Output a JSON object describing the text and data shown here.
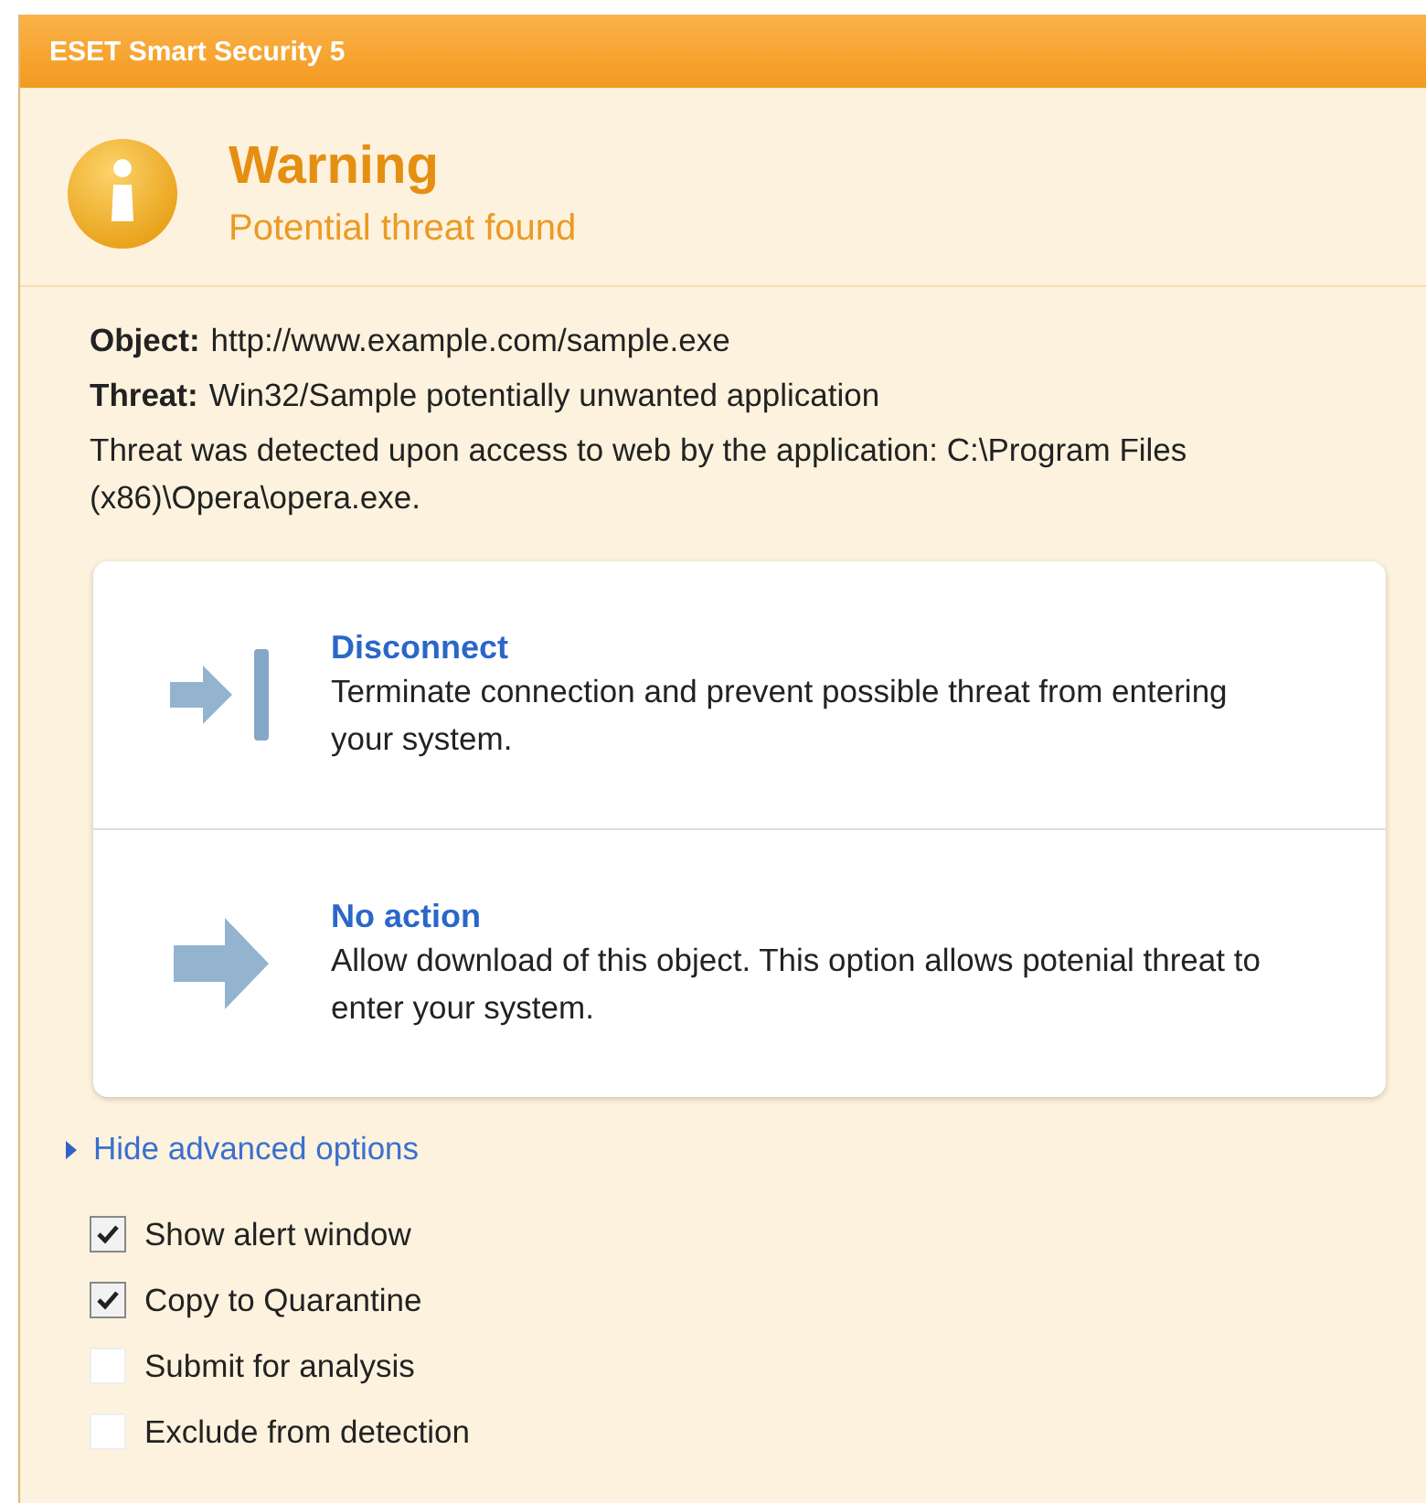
{
  "window": {
    "title": "ESET Smart Security 5"
  },
  "header": {
    "title": "Warning",
    "subtitle": "Potential threat found"
  },
  "details": [
    {
      "label": "Object:",
      "value": "http://www.example.com/sample.exe"
    },
    {
      "label": "Threat:",
      "value": "Win32/Sample potentially unwanted application"
    }
  ],
  "message": "Threat was detected upon access to web by the application: C:\\Program Files (x86)\\Opera\\opera.exe.",
  "actions": [
    {
      "kind": "disconnect",
      "title": "Disconnect",
      "description": "Terminate connection and prevent possible threat from entering your system."
    },
    {
      "kind": "no_action",
      "title": "No action",
      "description": "Allow download of this object. This option allows potenial threat to enter your system."
    }
  ],
  "advanced_link": "Hide advanced options",
  "options": [
    {
      "label": "Show alert window",
      "checked": true
    },
    {
      "label": "Copy to Quarantine",
      "checked": true
    },
    {
      "label": "Submit for analysis",
      "checked": false
    },
    {
      "label": "Exclude from detection",
      "checked": false
    }
  ]
}
